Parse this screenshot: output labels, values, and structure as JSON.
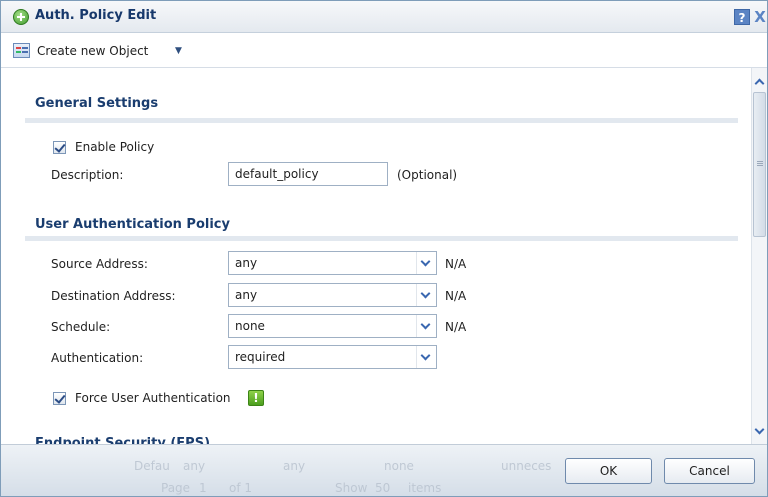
{
  "dialog": {
    "title": "Auth. Policy Edit",
    "help_label": "?",
    "close_label": "X"
  },
  "toolbar": {
    "create_label": "Create new Object",
    "caret": "▼"
  },
  "general": {
    "title": "General Settings",
    "enable_label": "Enable Policy",
    "enable_checked": true,
    "description_label": "Description:",
    "description_value": "default_policy",
    "optional_label": "(Optional)"
  },
  "uap": {
    "title": "User Authentication Policy",
    "rows": [
      {
        "label": "Source Address:",
        "value": "any",
        "note": "N/A"
      },
      {
        "label": "Destination Address:",
        "value": "any",
        "note": "N/A"
      },
      {
        "label": "Schedule:",
        "value": "none",
        "note": "N/A"
      },
      {
        "label": "Authentication:",
        "value": "required",
        "note": ""
      }
    ],
    "force_label": "Force User Authentication",
    "force_checked": true,
    "warn_symbol": "!"
  },
  "cut_section_title": "Endpoint Security (EPS)",
  "footer": {
    "ghost_row": [
      "Defau",
      "any",
      "any",
      "none",
      "unneces"
    ],
    "ghost_pager": [
      "Page",
      "1",
      "of 1",
      "Show",
      "50",
      "items"
    ],
    "ok_label": "OK",
    "cancel_label": "Cancel"
  }
}
